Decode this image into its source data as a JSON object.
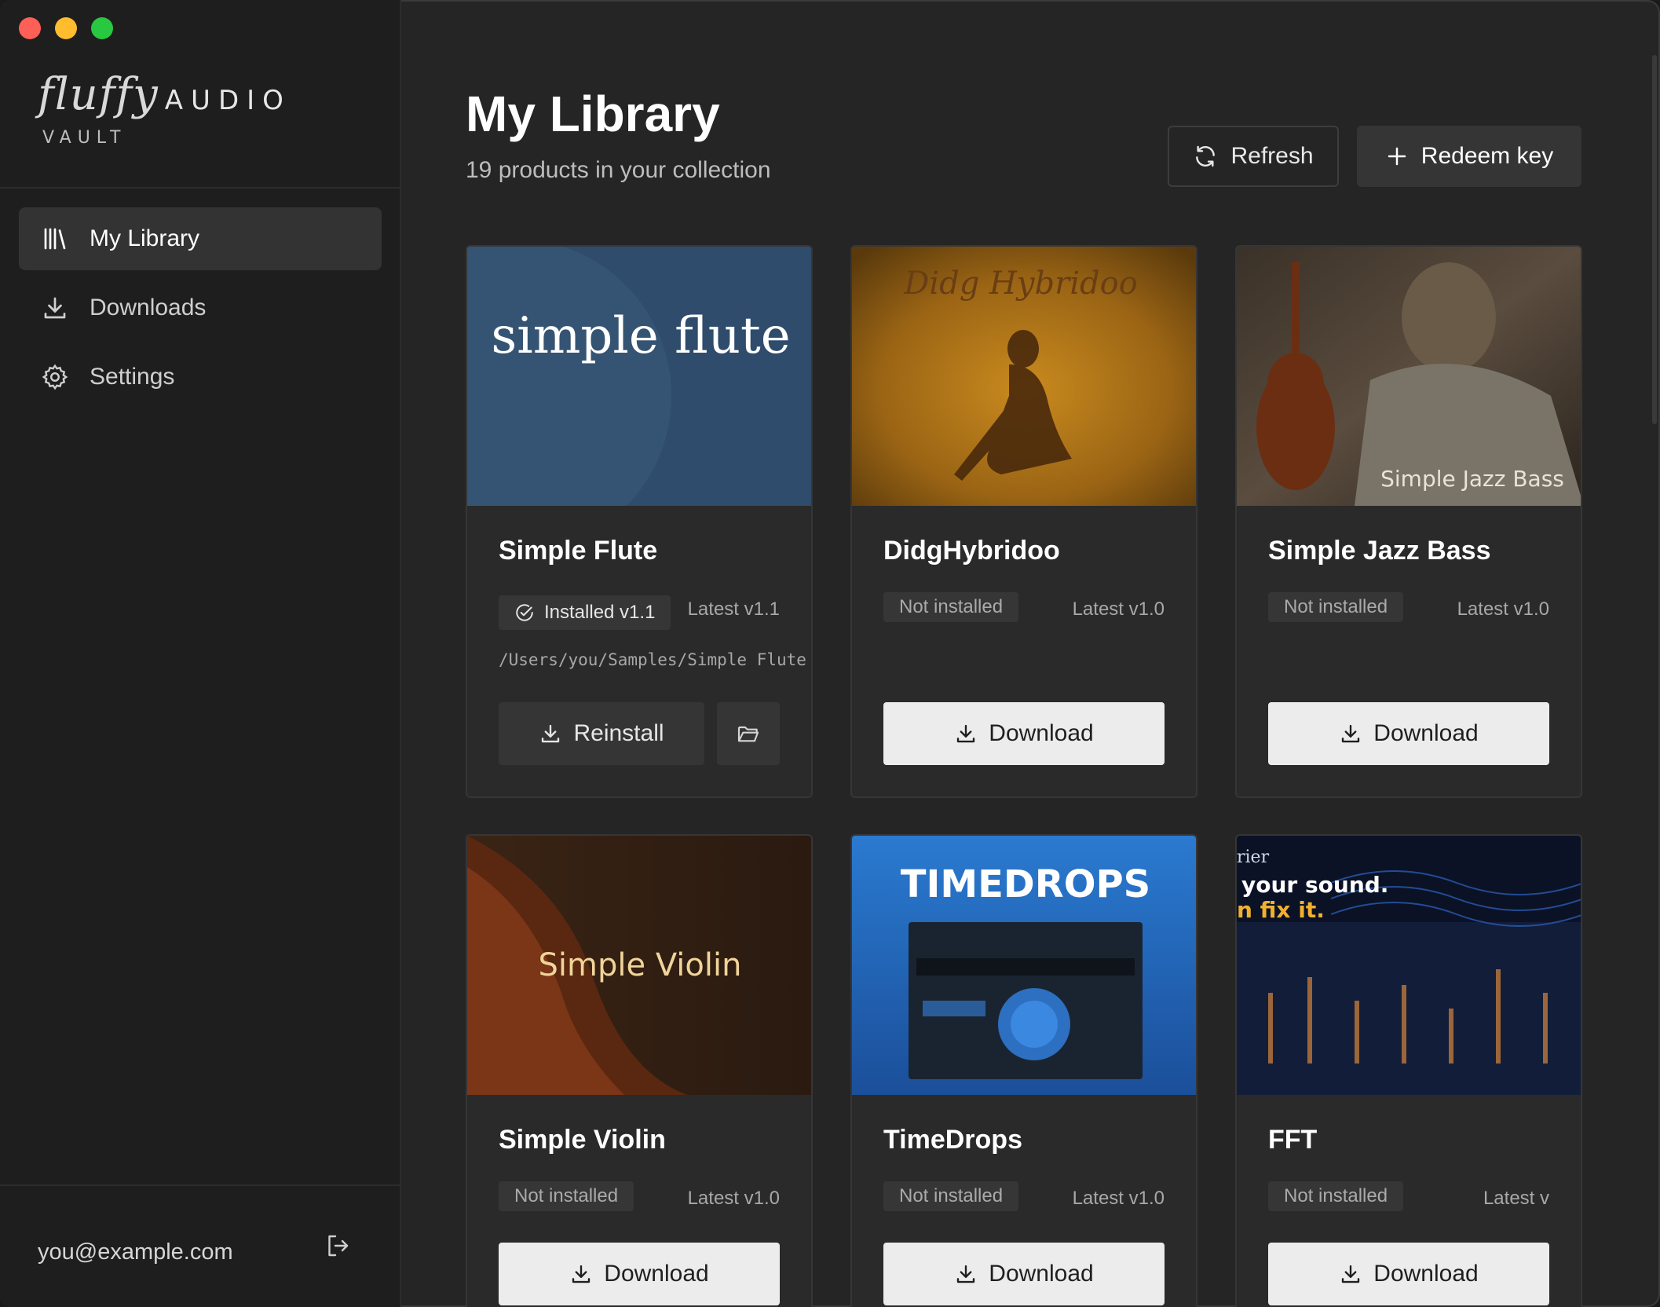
{
  "brand": {
    "name": "fluffy",
    "audio": "AUDIO",
    "vault": "VAULT"
  },
  "sidebar": {
    "items": [
      {
        "label": "My Library",
        "icon": "library-icon",
        "active": true
      },
      {
        "label": "Downloads",
        "icon": "download-icon",
        "active": false
      },
      {
        "label": "Settings",
        "icon": "gear-icon",
        "active": false
      }
    ],
    "user_email": "you@example.com"
  },
  "main": {
    "title": "My Library",
    "subtitle": "19 products in your collection",
    "refresh_label": "Refresh",
    "redeem_label": "Redeem key"
  },
  "products": [
    {
      "name": "Simple Flute",
      "status": "Installed v1.1",
      "latest": "Latest v1.1",
      "path": "/Users/you/Samples/Simple Flute",
      "action": "Reinstall",
      "art_text": "simple flute"
    },
    {
      "name": "DidgHybridoo",
      "status": "Not installed",
      "latest": "Latest v1.0",
      "action": "Download",
      "art_text": "Didg Hybridoo"
    },
    {
      "name": "Simple Jazz Bass",
      "status": "Not installed",
      "latest": "Latest v1.0",
      "action": "Download",
      "art_text": "Simple Jazz Bass"
    },
    {
      "name": "Simple Violin",
      "status": "Not installed",
      "latest": "Latest v1.0",
      "action": "Download",
      "art_text": "Simple Violin"
    },
    {
      "name": "TimeDrops",
      "status": "Not installed",
      "latest": "Latest v1.0",
      "action": "Download",
      "art_text": "TIMEDROPS"
    },
    {
      "name": "FFT",
      "status": "Not installed",
      "latest": "Latest v",
      "action": "Download",
      "art_lines": [
        "rier",
        "your sound.",
        "n fix it."
      ]
    }
  ],
  "colors": {
    "sidebar_bg": "#1e1e1e",
    "main_bg": "#252525",
    "card_bg": "#2a2a2a",
    "download_btn": "#ececec"
  }
}
